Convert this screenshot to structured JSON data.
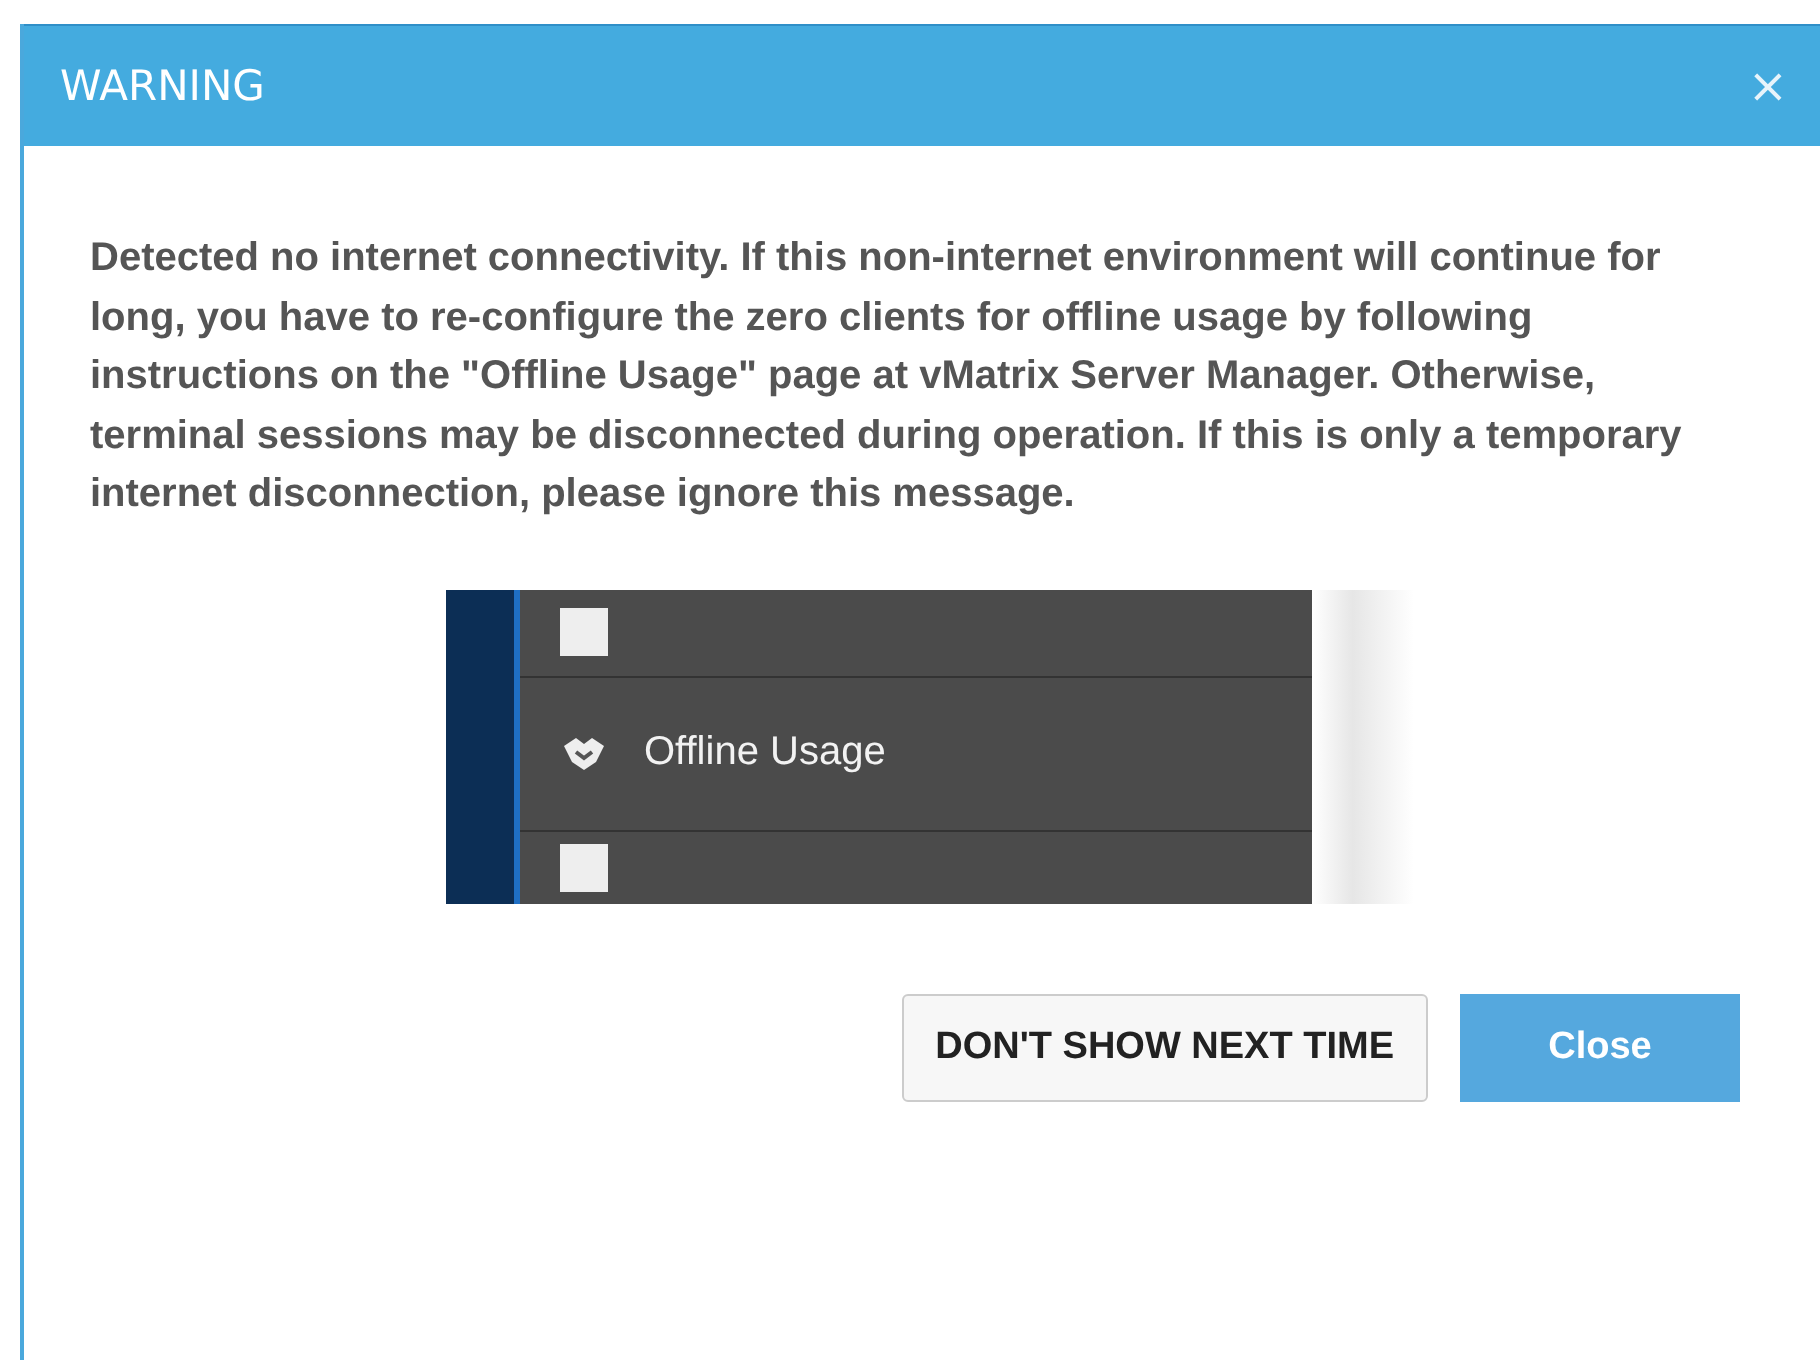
{
  "window": {
    "title": "WARNING",
    "close_glyph": "×"
  },
  "message": "Detected no internet connectivity. If this non-internet environment will continue for long, you have to re-configure the zero clients for offline usage by following instructions on the \"Offline Usage\" page at vMatrix Server Manager. Otherwise, terminal sessions may be disconnected during operation. If this is only a temporary internet disconnection, please ignore this message.",
  "menu_screenshot": {
    "items": [
      {
        "label": "Offline Usage"
      }
    ]
  },
  "buttons": [
    {
      "label": "DON'T SHOW NEXT TIME",
      "kind": "secondary"
    },
    {
      "label": "Close",
      "kind": "primary"
    }
  ]
}
